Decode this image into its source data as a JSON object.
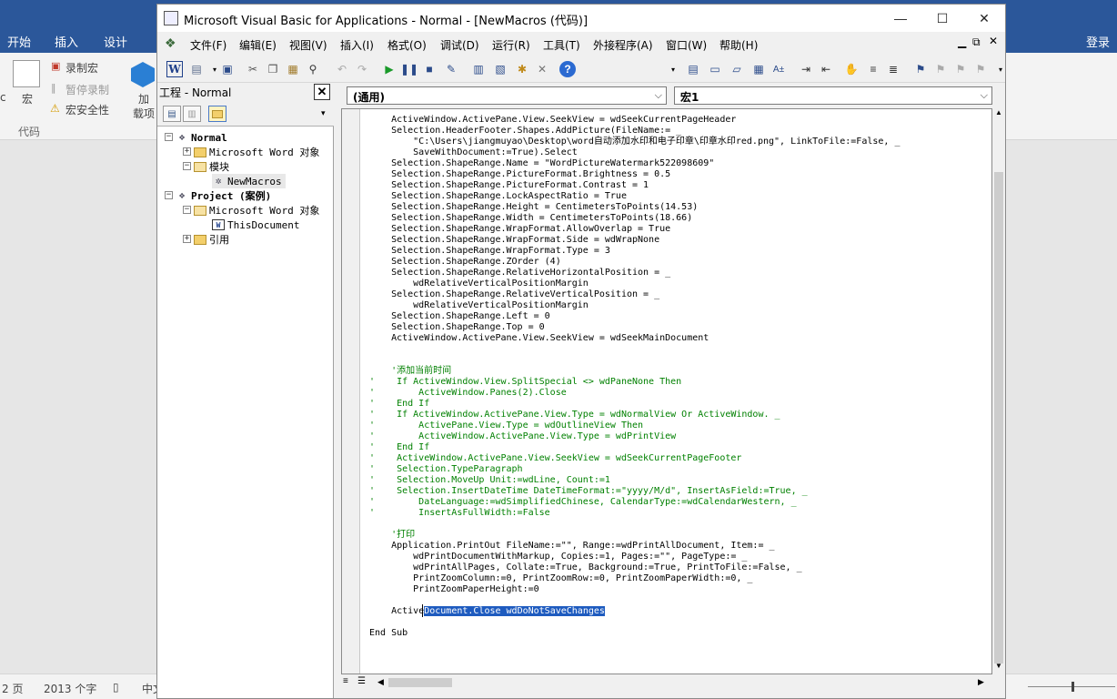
{
  "word": {
    "tabs": [
      "开始",
      "插入",
      "设计"
    ],
    "login": "登录",
    "ribbon": {
      "macros_label": "宏",
      "record_macro": "录制宏",
      "pause_recording": "暂停录制",
      "macro_security": "宏安全性",
      "group_label": "代码",
      "addin_label_1": "加",
      "addin_label_2": "载项",
      "left_c": "c"
    },
    "status": {
      "page": "2 页",
      "words": "2013 个字",
      "lang": "中文"
    }
  },
  "vba": {
    "title": "Microsoft Visual Basic for Applications - Normal - [NewMacros (代码)]",
    "menu": [
      "文件(F)",
      "编辑(E)",
      "视图(V)",
      "插入(I)",
      "格式(O)",
      "调试(D)",
      "运行(R)",
      "工具(T)",
      "外接程序(A)",
      "窗口(W)",
      "帮助(H)"
    ],
    "project": {
      "title": "工程 - Normal",
      "tree": {
        "normal": "Normal",
        "word_objects": "Microsoft Word 对象",
        "modules": "模块",
        "newmacros": "NewMacros",
        "project_case": "Project (案例)",
        "word_objects_2": "Microsoft Word 对象",
        "this_document": "ThisDocument",
        "references": "引用"
      }
    },
    "code": {
      "object_combo": "(通用)",
      "proc_combo": "宏1",
      "lines": [
        "    ActiveWindow.ActivePane.View.SeekView = wdSeekCurrentPageHeader",
        "    Selection.HeaderFooter.Shapes.AddPicture(FileName:= _",
        "        \"C:\\Users\\jiangmuyao\\Desktop\\word自动添加水印和电子印章\\印章水印red.png\", LinkToFile:=False, _",
        "        SaveWithDocument:=True).Select",
        "    Selection.ShapeRange.Name = \"WordPictureWatermark522098609\"",
        "    Selection.ShapeRange.PictureFormat.Brightness = 0.5",
        "    Selection.ShapeRange.PictureFormat.Contrast = 1",
        "    Selection.ShapeRange.LockAspectRatio = True",
        "    Selection.ShapeRange.Height = CentimetersToPoints(14.53)",
        "    Selection.ShapeRange.Width = CentimetersToPoints(18.66)",
        "    Selection.ShapeRange.WrapFormat.AllowOverlap = True",
        "    Selection.ShapeRange.WrapFormat.Side = wdWrapNone",
        "    Selection.ShapeRange.WrapFormat.Type = 3",
        "    Selection.ShapeRange.ZOrder (4)",
        "    Selection.ShapeRange.RelativeHorizontalPosition = _",
        "        wdRelativeVerticalPositionMargin",
        "    Selection.ShapeRange.RelativeVerticalPosition = _",
        "        wdRelativeVerticalPositionMargin",
        "    Selection.ShapeRange.Left = 0",
        "    Selection.ShapeRange.Top = 0",
        "    ActiveWindow.ActivePane.View.SeekView = wdSeekMainDocument",
        "",
        "",
        "    '添加当前时间",
        "'    If ActiveWindow.View.SplitSpecial <> wdPaneNone Then",
        "'        ActiveWindow.Panes(2).Close",
        "'    End If",
        "'    If ActiveWindow.ActivePane.View.Type = wdNormalView Or ActiveWindow. _",
        "'        ActivePane.View.Type = wdOutlineView Then",
        "'        ActiveWindow.ActivePane.View.Type = wdPrintView",
        "'    End If",
        "'    ActiveWindow.ActivePane.View.SeekView = wdSeekCurrentPageFooter",
        "'    Selection.TypeParagraph",
        "'    Selection.MoveUp Unit:=wdLine, Count:=1",
        "'    Selection.InsertDateTime DateTimeFormat:=\"yyyy/M/d\", InsertAsField:=True, _",
        "'        DateLanguage:=wdSimplifiedChinese, CalendarType:=wdCalendarWestern, _",
        "'        InsertAsFullWidth:=False",
        "",
        "    '打印",
        "    Application.PrintOut FileName:=\"\", Range:=wdPrintAllDocument, Item:= _",
        "        wdPrintDocumentWithMarkup, Copies:=1, Pages:=\"\", PageType:= _",
        "        wdPrintAllPages, Collate:=True, Background:=True, PrintToFile:=False, _",
        "        PrintZoomColumn:=0, PrintZoomRow:=0, PrintZoomPaperWidth:=0, _",
        "        PrintZoomPaperHeight:=0",
        "",
        "    Active",
        "",
        "End Sub"
      ],
      "selected_text": "Document.Close wdDoNotSaveChanges"
    }
  },
  "colors": {
    "word_blue": "#2b579a",
    "comment_green": "#008000",
    "selection_blue": "#1e5bbf"
  }
}
